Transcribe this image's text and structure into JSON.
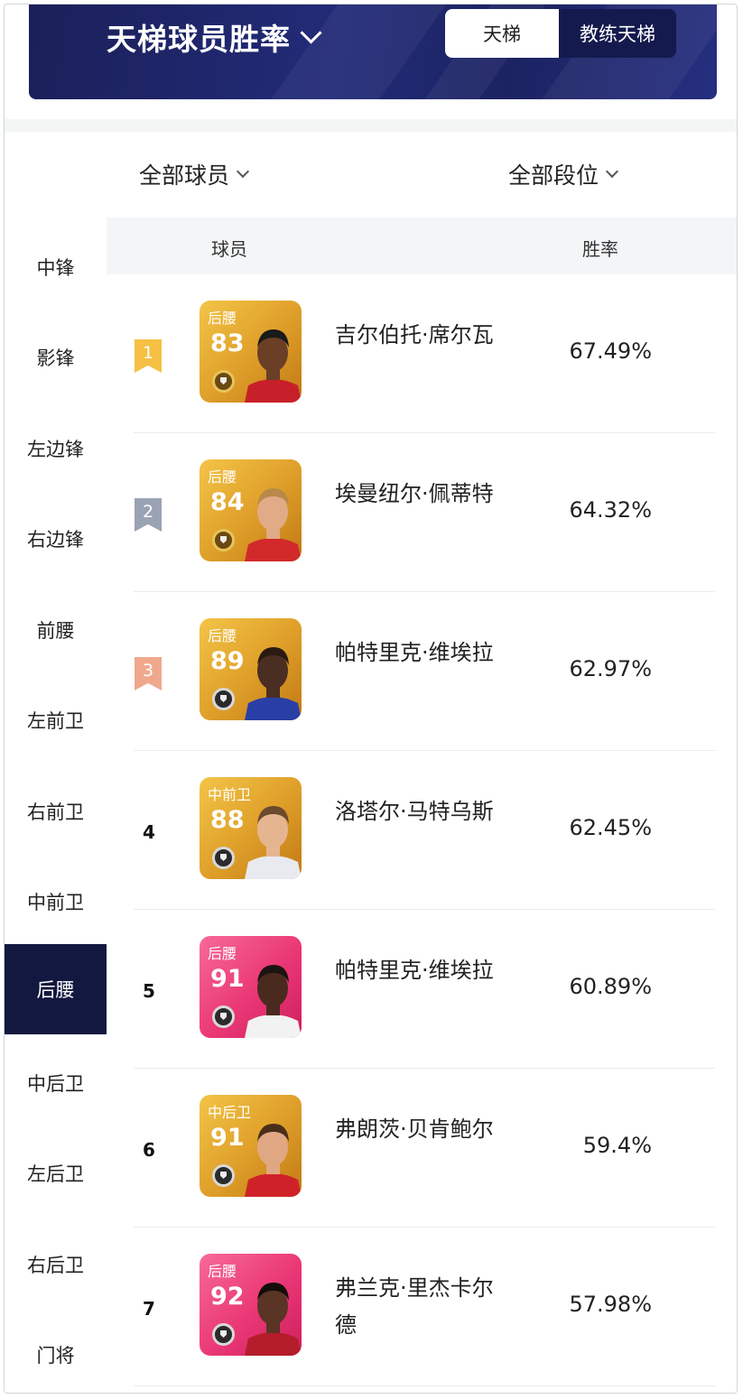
{
  "header": {
    "title": "天梯球员胜率",
    "tabs": [
      {
        "label": "天梯",
        "active": true
      },
      {
        "label": "教练天梯",
        "active": false
      }
    ]
  },
  "filters": {
    "players": "全部球员",
    "tiers": "全部段位"
  },
  "sidebar": {
    "items": [
      {
        "label": "中锋"
      },
      {
        "label": "影锋"
      },
      {
        "label": "左边锋"
      },
      {
        "label": "右边锋"
      },
      {
        "label": "前腰"
      },
      {
        "label": "左前卫"
      },
      {
        "label": "右前卫"
      },
      {
        "label": "中前卫"
      },
      {
        "label": "后腰",
        "active": true
      },
      {
        "label": "中后卫"
      },
      {
        "label": "左后卫"
      },
      {
        "label": "右后卫"
      },
      {
        "label": "门将"
      }
    ]
  },
  "table": {
    "headers": {
      "player": "球员",
      "win_rate": "胜率"
    },
    "rows": [
      {
        "rank": "1",
        "card_position": "后腰",
        "rating": "83",
        "name": "吉尔伯托·席尔瓦",
        "win_rate": "67.49%",
        "card_style": "gold",
        "skin": "#6b3f26",
        "hair": "#1a1a1a",
        "shirt": "#c8202a"
      },
      {
        "rank": "2",
        "card_position": "后腰",
        "rating": "84",
        "name": "埃曼纽尔·佩蒂特",
        "win_rate": "64.32%",
        "card_style": "gold",
        "skin": "#e0ab86",
        "hair": "#b9894a",
        "shirt": "#d22a2a"
      },
      {
        "rank": "3",
        "card_position": "后腰",
        "rating": "89",
        "name": "帕特里克·维埃拉",
        "win_rate": "62.97%",
        "card_style": "gold",
        "skin": "#4b2e22",
        "hair": "#2a1a12",
        "shirt": "#2a3fa6"
      },
      {
        "rank": "4",
        "card_position": "中前卫",
        "rating": "88",
        "name": "洛塔尔·马特乌斯",
        "win_rate": "62.45%",
        "card_style": "gold",
        "skin": "#e5b592",
        "hair": "#6b4a2e",
        "shirt": "#e8eaf0"
      },
      {
        "rank": "5",
        "card_position": "后腰",
        "rating": "91",
        "name": "帕特里克·维埃拉",
        "win_rate": "60.89%",
        "card_style": "pink",
        "skin": "#4a2a1f",
        "hair": "#1c1410",
        "shirt": "#f2f2f2"
      },
      {
        "rank": "6",
        "card_position": "中后卫",
        "rating": "91",
        "name": "弗朗茨·贝肯鲍尔",
        "win_rate": "59.4%",
        "card_style": "gold",
        "skin": "#e0a783",
        "hair": "#4a2e1c",
        "shirt": "#cf2228"
      },
      {
        "rank": "7",
        "card_position": "后腰",
        "rating": "92",
        "name": "弗兰克·里杰卡尔德",
        "win_rate": "57.98%",
        "card_style": "pink",
        "skin": "#5a3424",
        "hair": "#140d0a",
        "shirt": "#b51d2a"
      }
    ]
  },
  "colors": {
    "banner": "#1f2566",
    "active_sidebar": "#12183f",
    "rank_gold": "#f5c044",
    "rank_silver": "#9aa3b3",
    "rank_bronze": "#f0a88d"
  }
}
